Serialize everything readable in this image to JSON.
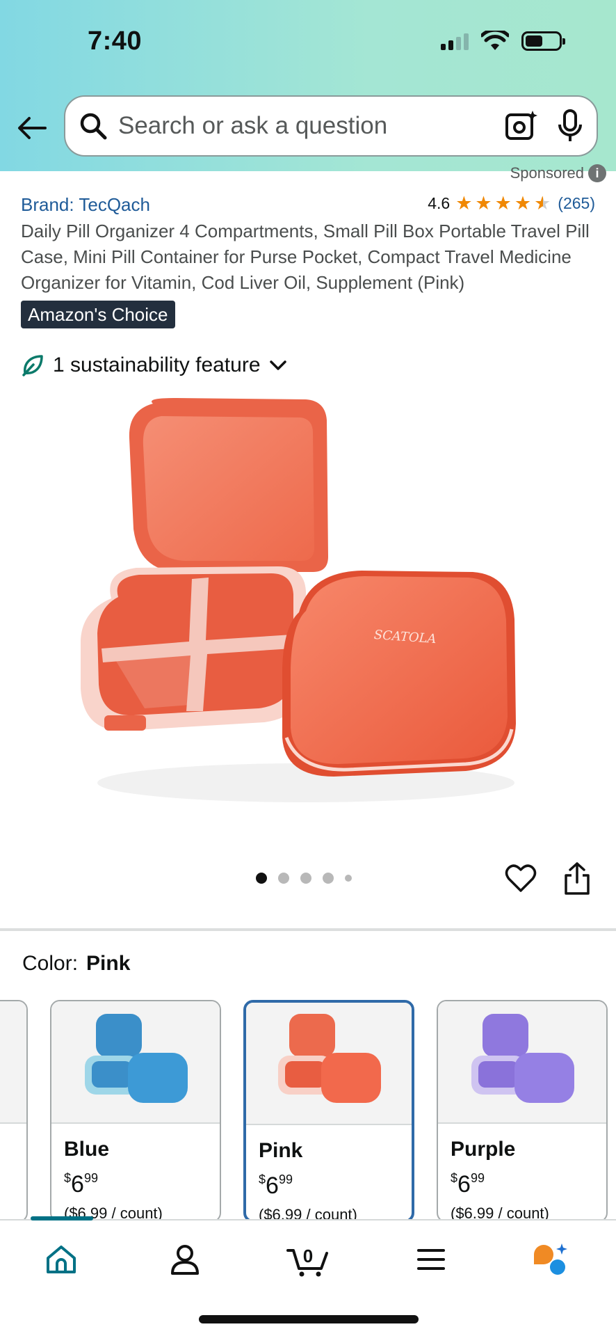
{
  "status_bar": {
    "time": "7:40"
  },
  "search": {
    "placeholder": "Search or ask a question"
  },
  "sponsored_label": "Sponsored",
  "product": {
    "brand": "Brand: TecQach",
    "rating_value": "4.6",
    "rating_stars": 4.6,
    "review_count": "(265)",
    "title": "Daily Pill Organizer 4 Compartments, Small Pill Box Portable Travel Pill Case, Mini Pill Container for Purse Pocket, Compact Travel Medicine Organizer for Vitamin, Cod Liver Oil, Supplement (Pink)",
    "badge": "Amazon's Choice",
    "sustainability": "1 sustainability feature",
    "image_brand_text": "SCATOLA",
    "carousel": {
      "total": 5,
      "active_index": 0
    }
  },
  "color": {
    "label": "Color:",
    "selected": "Pink",
    "options": [
      {
        "name": "Blue",
        "price_symbol": "$",
        "price_whole": "6",
        "price_cents": "99",
        "unit": "($6.99 / count)"
      },
      {
        "name": "Pink",
        "price_symbol": "$",
        "price_whole": "6",
        "price_cents": "99",
        "unit": "($6.99 / count)"
      },
      {
        "name": "Purple",
        "price_symbol": "$",
        "price_whole": "6",
        "price_cents": "99",
        "unit": "($6.99 / count)"
      }
    ]
  },
  "bottom_nav": {
    "cart_count": "0"
  },
  "colors": {
    "accent_teal": "#007185",
    "link_blue": "#1f5b98",
    "star_orange": "#f08804",
    "badge_bg": "#232f3e",
    "selected_border": "#2f6aa8",
    "product_orange": "#f26a4b"
  },
  "icons": [
    "back-arrow-icon",
    "search-icon",
    "camera-icon",
    "mic-icon",
    "leaf-icon",
    "chevron-down-icon",
    "heart-icon",
    "share-icon",
    "home-icon",
    "account-icon",
    "cart-icon",
    "menu-icon",
    "rufus-icon"
  ]
}
